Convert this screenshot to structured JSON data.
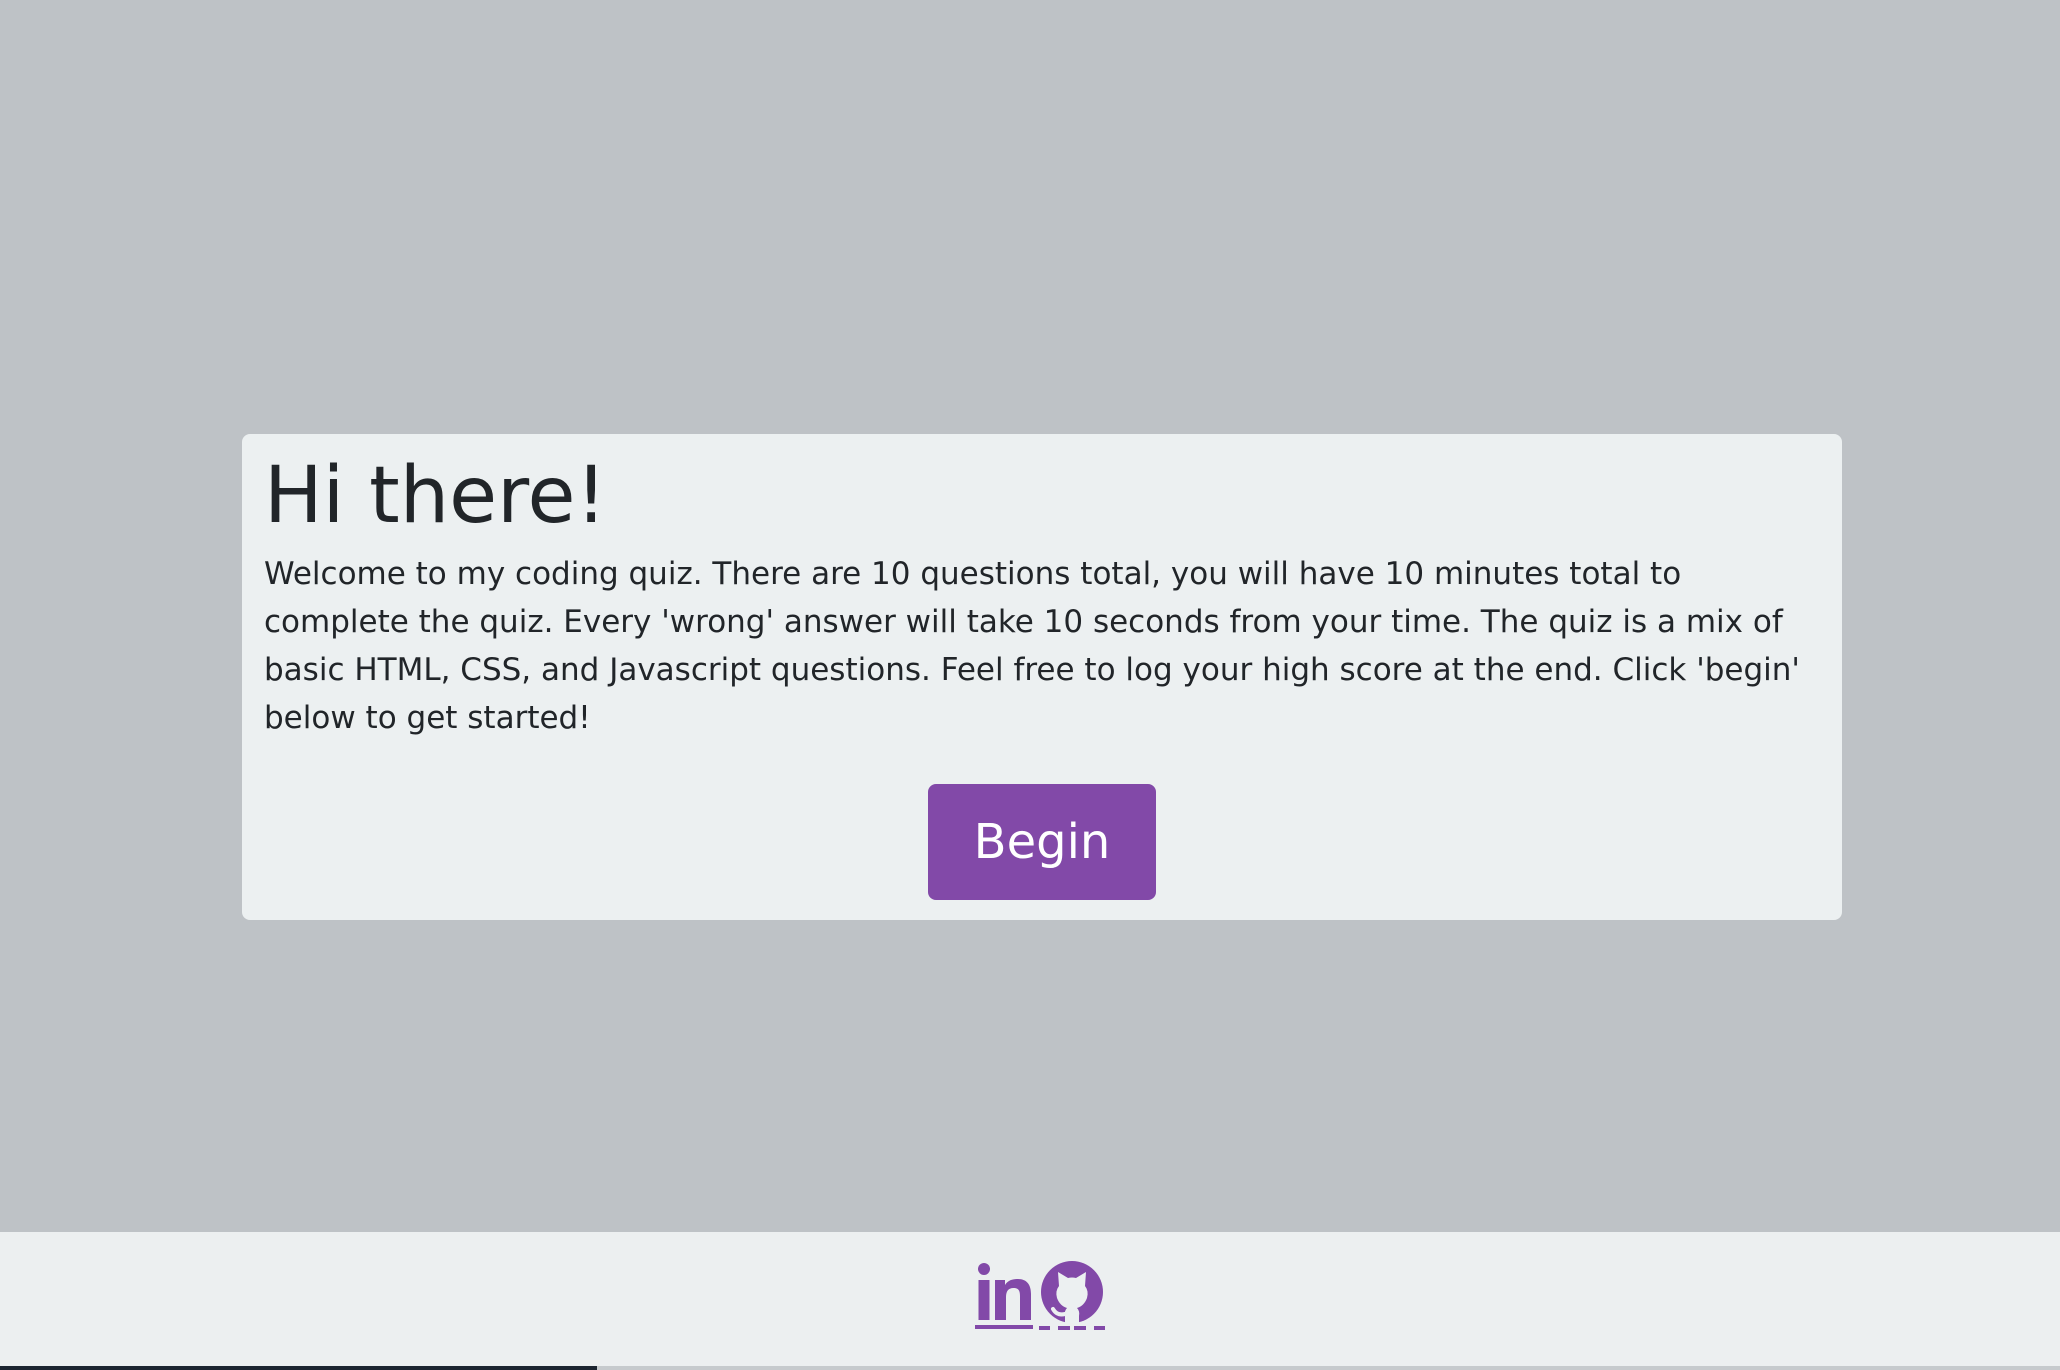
{
  "card": {
    "title": "Hi there!",
    "body": "Welcome to my coding quiz. There are 10 questions total, you will have 10 minutes total to complete the quiz. Every 'wrong' answer will take 10 seconds from your time. The quiz is a mix of basic HTML, CSS, and Javascript questions. Feel free to log your high score at the end. Click 'begin' below to get started!",
    "begin_label": "Begin"
  },
  "footer": {
    "links": [
      {
        "icon": "linkedin-icon"
      },
      {
        "icon": "github-icon"
      }
    ]
  },
  "colors": {
    "page_background": "#bec2c6",
    "card_background": "#ecf0f1",
    "accent": "#8249a8",
    "text": "#212529",
    "footer_background": "#eceff0"
  }
}
